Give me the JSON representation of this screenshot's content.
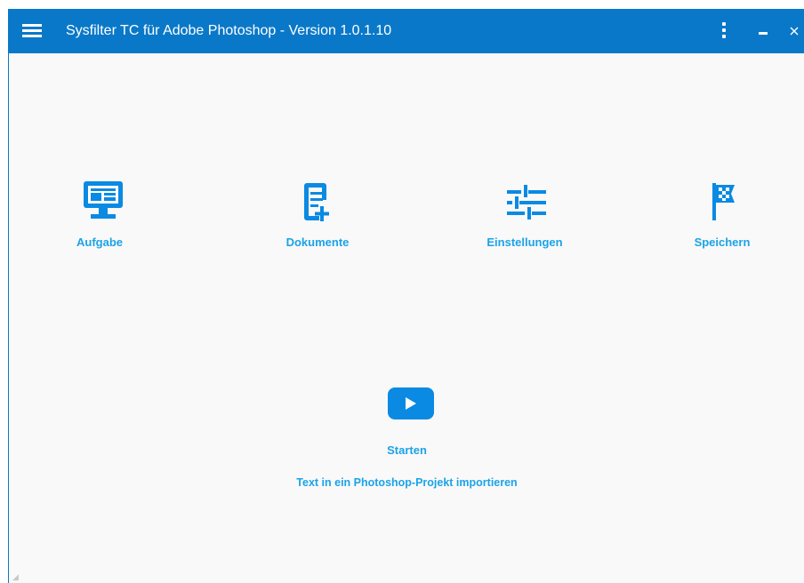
{
  "window": {
    "title": "Sysfilter TC für Adobe Photoshop - Version 1.0.1.10"
  },
  "titlebar": {
    "menu_icon": "hamburger-menu-icon",
    "more_icon": "vertical-ellipsis-icon",
    "minimize_icon": "minimize-icon",
    "close_icon": "close-icon"
  },
  "tiles": [
    {
      "label": "Aufgabe",
      "icon": "monitor-icon"
    },
    {
      "label": "Dokumente",
      "icon": "document-add-icon"
    },
    {
      "label": "Einstellungen",
      "icon": "sliders-icon"
    },
    {
      "label": "Speichern",
      "icon": "checkered-flag-icon"
    }
  ],
  "start": {
    "icon": "play-button-icon",
    "label": "Starten",
    "description": "Text in ein Photoshop-Projekt importieren"
  },
  "colors": {
    "titlebar": "#0a78c8",
    "accent": "#1aa3e8",
    "icon": "#0a8ae2",
    "background": "#f9f9f9"
  }
}
